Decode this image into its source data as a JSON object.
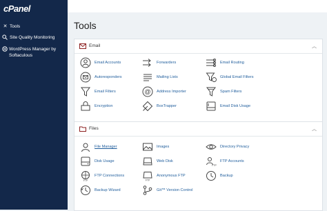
{
  "sidebar": {
    "logo": "cPanel",
    "items": [
      {
        "label": "Tools",
        "icon": "tools-icon"
      },
      {
        "label": "Site Quality Monitoring",
        "icon": "magnifier-icon"
      },
      {
        "label": "WordPress Manager by Softaculous",
        "icon": "wordpress-icon"
      }
    ]
  },
  "page": {
    "title": "Tools"
  },
  "email_section": {
    "title": "Email",
    "items": [
      {
        "label": "Email Accounts",
        "icon": "user-icon"
      },
      {
        "label": "Forwarders",
        "icon": "forward-arrows-icon"
      },
      {
        "label": "Email Routing",
        "icon": "routing-icon"
      },
      {
        "label": "Autoresponders",
        "icon": "autoresponder-icon"
      },
      {
        "label": "Mailing Lists",
        "icon": "list-icon"
      },
      {
        "label": "Global Email Filters",
        "icon": "global-filter-icon"
      },
      {
        "label": "Email Filters",
        "icon": "filter-icon"
      },
      {
        "label": "Address Importer",
        "icon": "at-icon"
      },
      {
        "label": "Spam Filters",
        "icon": "spam-filter-icon"
      },
      {
        "label": "Encryption",
        "icon": "encryption-icon"
      },
      {
        "label": "BoxTrapper",
        "icon": "boxtrapper-icon"
      },
      {
        "label": "Email Disk Usage",
        "icon": "disk-usage-icon"
      }
    ]
  },
  "files_section": {
    "title": "Files",
    "items": [
      {
        "label": "File Manager",
        "icon": "file-manager-icon"
      },
      {
        "label": "Images",
        "icon": "images-icon"
      },
      {
        "label": "Directory Privacy",
        "icon": "eye-icon"
      },
      {
        "label": "Disk Usage",
        "icon": "disk-icon"
      },
      {
        "label": "Web Disk",
        "icon": "web-disk-icon"
      },
      {
        "label": "FTP Accounts",
        "icon": "ftp-accounts-icon"
      },
      {
        "label": "FTP Connections",
        "icon": "ftp-connections-icon"
      },
      {
        "label": "Anonymous FTP",
        "icon": "anonymous-ftp-icon"
      },
      {
        "label": "Backup",
        "icon": "backup-icon"
      },
      {
        "label": "Backup Wizard",
        "icon": "backup-wizard-icon"
      },
      {
        "label": "Git™ Version Control",
        "icon": "git-icon"
      }
    ]
  },
  "colors": {
    "sidebar": "#13284a",
    "link": "#1f5d9c",
    "icon_stroke": "#444444",
    "background": "#eef2f5"
  }
}
